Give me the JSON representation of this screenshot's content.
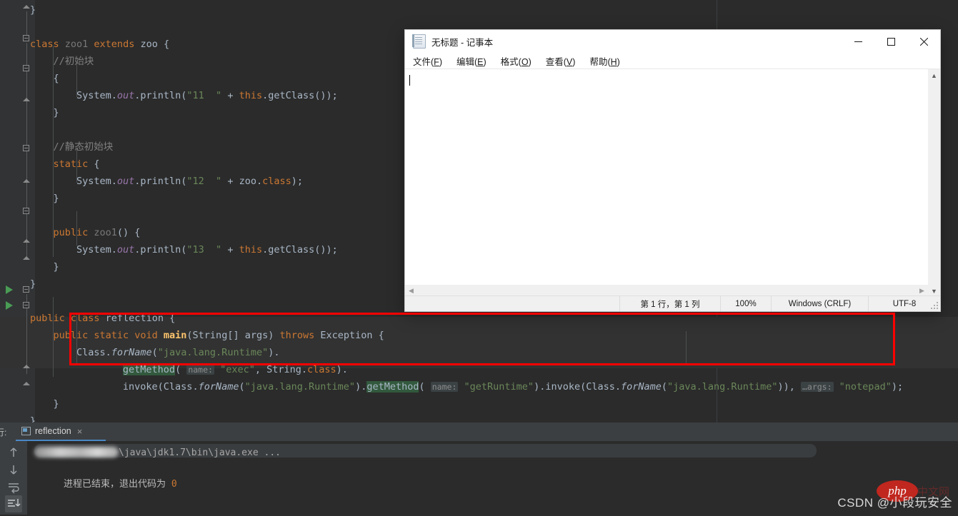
{
  "ide": {
    "code_lines": [
      {
        "indent": 0,
        "tokens": [
          {
            "t": "}",
            "c": "plain"
          }
        ]
      },
      {
        "indent": 0,
        "tokens": []
      },
      {
        "indent": 0,
        "tokens": [
          {
            "t": "class ",
            "c": "kw"
          },
          {
            "t": "zoo1",
            "c": "dim"
          },
          {
            "t": " extends ",
            "c": "kw"
          },
          {
            "t": "zoo",
            "c": "plain"
          },
          {
            "t": " {",
            "c": "plain"
          }
        ]
      },
      {
        "indent": 1,
        "tokens": [
          {
            "t": "//初始块",
            "c": "cmt"
          }
        ]
      },
      {
        "indent": 1,
        "tokens": [
          {
            "t": "{",
            "c": "plain"
          }
        ]
      },
      {
        "indent": 2,
        "tokens": [
          {
            "t": "System.",
            "c": "plain"
          },
          {
            "t": "out",
            "c": "fld"
          },
          {
            "t": ".println(",
            "c": "plain"
          },
          {
            "t": "\"11  \"",
            "c": "str"
          },
          {
            "t": " + ",
            "c": "plain"
          },
          {
            "t": "this",
            "c": "kw"
          },
          {
            "t": ".getClass());",
            "c": "plain"
          }
        ]
      },
      {
        "indent": 1,
        "tokens": [
          {
            "t": "}",
            "c": "plain"
          }
        ]
      },
      {
        "indent": 0,
        "tokens": []
      },
      {
        "indent": 1,
        "tokens": [
          {
            "t": "//静态初始块",
            "c": "cmt"
          }
        ]
      },
      {
        "indent": 1,
        "tokens": [
          {
            "t": "static",
            "c": "kw"
          },
          {
            "t": " {",
            "c": "plain"
          }
        ]
      },
      {
        "indent": 2,
        "tokens": [
          {
            "t": "System.",
            "c": "plain"
          },
          {
            "t": "out",
            "c": "fld"
          },
          {
            "t": ".println(",
            "c": "plain"
          },
          {
            "t": "\"12  \"",
            "c": "str"
          },
          {
            "t": " + zoo.",
            "c": "plain"
          },
          {
            "t": "class",
            "c": "kw"
          },
          {
            "t": ");",
            "c": "plain"
          }
        ]
      },
      {
        "indent": 1,
        "tokens": [
          {
            "t": "}",
            "c": "plain"
          }
        ]
      },
      {
        "indent": 0,
        "tokens": []
      },
      {
        "indent": 1,
        "tokens": [
          {
            "t": "public ",
            "c": "kw"
          },
          {
            "t": "zoo1",
            "c": "dim"
          },
          {
            "t": "() {",
            "c": "plain"
          }
        ]
      },
      {
        "indent": 2,
        "tokens": [
          {
            "t": "System.",
            "c": "plain"
          },
          {
            "t": "out",
            "c": "fld"
          },
          {
            "t": ".println(",
            "c": "plain"
          },
          {
            "t": "\"13  \"",
            "c": "str"
          },
          {
            "t": " + ",
            "c": "plain"
          },
          {
            "t": "this",
            "c": "kw"
          },
          {
            "t": ".getClass());",
            "c": "plain"
          }
        ]
      },
      {
        "indent": 1,
        "tokens": [
          {
            "t": "}",
            "c": "plain"
          }
        ]
      },
      {
        "indent": 0,
        "tokens": [
          {
            "t": "}",
            "c": "plain"
          }
        ]
      },
      {
        "indent": 0,
        "tokens": []
      },
      {
        "indent": 0,
        "tokens": [
          {
            "t": "public class ",
            "c": "kw"
          },
          {
            "t": "reflection",
            "c": "plain"
          },
          {
            "t": " {",
            "c": "plain"
          }
        ]
      },
      {
        "indent": 1,
        "tokens": [
          {
            "t": "public static ",
            "c": "kw"
          },
          {
            "t": "void ",
            "c": "kw"
          },
          {
            "t": "main",
            "c": "mth-b"
          },
          {
            "t": "(String[] args) ",
            "c": "plain"
          },
          {
            "t": "throws ",
            "c": "kw"
          },
          {
            "t": "Exception {",
            "c": "plain"
          }
        ]
      },
      {
        "indent": 2,
        "tokens": [
          {
            "t": "Class.",
            "c": "plain"
          },
          {
            "t": "forName",
            "c": "ital"
          },
          {
            "t": "(",
            "c": "plain"
          },
          {
            "t": "\"java.lang.Runtime\"",
            "c": "str"
          },
          {
            "t": ").",
            "c": "plain"
          }
        ]
      },
      {
        "indent": 4,
        "tokens": [
          {
            "t": "getMethod",
            "c": "usage"
          },
          {
            "t": "( ",
            "c": "plain"
          },
          {
            "t": "name:",
            "c": "hint"
          },
          {
            "t": " ",
            "c": "plain"
          },
          {
            "t": "\"exec\"",
            "c": "str"
          },
          {
            "t": ", String.",
            "c": "plain"
          },
          {
            "t": "class",
            "c": "kw"
          },
          {
            "t": ").",
            "c": "plain"
          }
        ]
      },
      {
        "indent": 4,
        "tokens": [
          {
            "t": "invoke(Class.",
            "c": "plain"
          },
          {
            "t": "forName",
            "c": "ital"
          },
          {
            "t": "(",
            "c": "plain"
          },
          {
            "t": "\"java.lang.Runtime\"",
            "c": "str"
          },
          {
            "t": ").",
            "c": "plain"
          },
          {
            "t": "getMethod",
            "c": "usage"
          },
          {
            "t": "( ",
            "c": "plain"
          },
          {
            "t": "name:",
            "c": "hint"
          },
          {
            "t": " ",
            "c": "plain"
          },
          {
            "t": "\"getRuntime\"",
            "c": "str"
          },
          {
            "t": ").invoke(Class.",
            "c": "plain"
          },
          {
            "t": "forName",
            "c": "ital"
          },
          {
            "t": "(",
            "c": "plain"
          },
          {
            "t": "\"java.lang.Runtime\"",
            "c": "str"
          },
          {
            "t": ")), ",
            "c": "plain"
          },
          {
            "t": "…args:",
            "c": "hint"
          },
          {
            "t": " ",
            "c": "plain"
          },
          {
            "t": "\"notepad\"",
            "c": "str"
          },
          {
            "t": ");",
            "c": "plain"
          }
        ]
      },
      {
        "indent": 1,
        "tokens": [
          {
            "t": "}",
            "c": "plain"
          }
        ]
      },
      {
        "indent": 0,
        "tokens": [
          {
            "t": "}",
            "c": "plain"
          }
        ]
      }
    ],
    "annotation": {
      "shape": "rectangle",
      "color": "#ff0000"
    },
    "colors": {
      "editor_bg": "#2b2b2b",
      "gutter_bg": "#313335",
      "keyword": "#cc7832",
      "string": "#6a8759",
      "comment": "#808080",
      "field": "#9876aa",
      "method": "#ffc66d",
      "default_text": "#a9b7c6",
      "usage_highlight": "#32593d",
      "run_arrow": "#499c54",
      "accent": "#ff0000"
    }
  },
  "console": {
    "run_label": "行:",
    "tab_label": "reflection",
    "tab_close": "×",
    "command_line": "\\java\\jdk1.7\\bin\\java.exe ...",
    "output_line": "进程已结束，退出代码为 ",
    "exit_code": "0",
    "toolbar": {
      "up": "up-arrow",
      "down": "down-arrow",
      "soft_wrap": "soft-wrap",
      "scroll_end": "scroll-to-end"
    }
  },
  "notepad": {
    "title": "无标题 - 记事本",
    "icon": "notepad-icon",
    "controls": {
      "minimize": "—",
      "maximize": "□",
      "close": "✕"
    },
    "menu": [
      {
        "label": "文件",
        "accel": "F"
      },
      {
        "label": "编辑",
        "accel": "E"
      },
      {
        "label": "格式",
        "accel": "O"
      },
      {
        "label": "查看",
        "accel": "V"
      },
      {
        "label": "帮助",
        "accel": "H"
      }
    ],
    "text_value": "",
    "status": {
      "position": "第 1 行，第 1 列",
      "zoom": "100%",
      "line_ending": "Windows (CRLF)",
      "encoding": "UTF-8"
    }
  },
  "watermark": {
    "text": "CSDN @小段玩安全",
    "logo_text": "php",
    "logo_suffix": "中文网"
  }
}
